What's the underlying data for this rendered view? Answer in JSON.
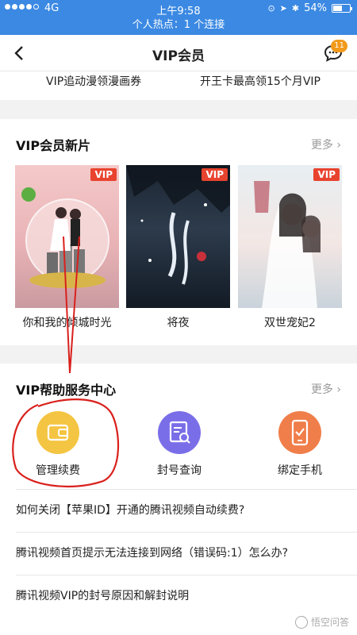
{
  "status_bar": {
    "carrier": "4G",
    "time": "上午9:58",
    "battery": "54%",
    "battery_level": 0.54
  },
  "hotspot_banner": "个人热点：1 个连接",
  "nav": {
    "title": "VIP会员",
    "message_badge": "11"
  },
  "promo": {
    "left": "VIP追动漫领漫画券",
    "right": "开王卡最高领15个月VIP"
  },
  "new_movies": {
    "title": "VIP会员新片",
    "more": "更多",
    "items": [
      {
        "name": "你和我的倾城时光",
        "tag": "VIP",
        "poster_text": "你和我的倾城时光"
      },
      {
        "name": "将夜",
        "tag": "VIP",
        "poster_text": "将夜"
      },
      {
        "name": "双世宠妃2",
        "tag": "VIP",
        "poster_text": "双世宠妃"
      }
    ]
  },
  "help_center": {
    "title": "VIP帮助服务中心",
    "more": "更多",
    "services": [
      {
        "label": "管理续费",
        "icon": "wallet-icon",
        "color": "#f4c542"
      },
      {
        "label": "封号查询",
        "icon": "search-doc-icon",
        "color": "#7a6ee8"
      },
      {
        "label": "绑定手机",
        "icon": "phone-check-icon",
        "color": "#f07e4a"
      }
    ],
    "faqs": [
      "如何关闭【苹果ID】开通的腾讯视频自动续费?",
      "腾讯视频首页提示无法连接到网络（错误码:1）怎么办?",
      "腾讯视频VIP的封号原因和解封说明"
    ]
  },
  "colors": {
    "status_bar": "#3b89e3",
    "vip_tag": "#e8432f",
    "annotation": "#d9201c"
  },
  "watermark": "悟空问答"
}
